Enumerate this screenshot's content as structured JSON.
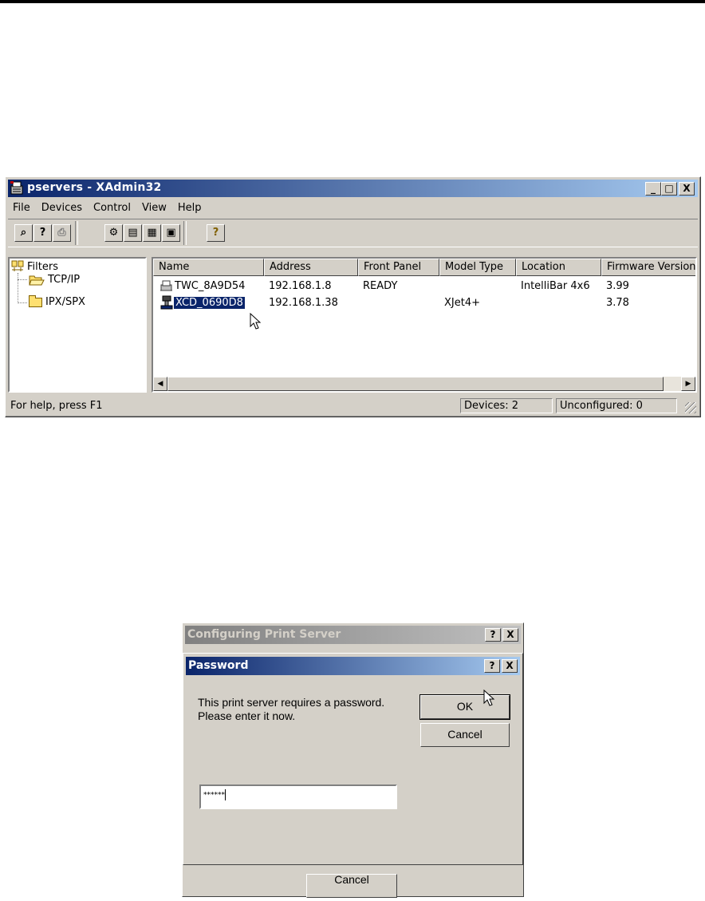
{
  "main_window": {
    "title": "pservers - XAdmin32",
    "caption_buttons": {
      "minimize": "_",
      "maximize": "□",
      "close": "X"
    },
    "menu": [
      "File",
      "Devices",
      "Control",
      "View",
      "Help"
    ],
    "toolbar_icons": [
      "search-device-icon",
      "unknown-device-icon",
      "printer-disabled-icon",
      "configure-icon",
      "status-panel-icon",
      "print-test-icon",
      "save-icon",
      "help-icon"
    ],
    "tree": {
      "root": "Filters",
      "children": [
        "TCP/IP",
        "IPX/SPX"
      ]
    },
    "columns": [
      "Name",
      "Address",
      "Front Panel",
      "Model Type",
      "Location",
      "Firmware Version"
    ],
    "rows": [
      {
        "name": "TWC_8A9D54",
        "address": "192.168.1.8",
        "front_panel": "READY",
        "model_type": "",
        "location": "IntelliBar 4x6",
        "firmware": "3.99"
      },
      {
        "name": "XCD_0690D8",
        "address": "192.168.1.38",
        "front_panel": "",
        "model_type": "XJet4+",
        "location": "",
        "firmware": "3.78"
      }
    ],
    "status": {
      "help": "For help, press F1",
      "devices": "Devices: 2",
      "unconfigured": "Unconfigured: 0"
    }
  },
  "back_dialog": {
    "title": "Configuring Print Server",
    "buttons": {
      "help": "?",
      "close": "X"
    },
    "cancel_label": "Cancel"
  },
  "password_dialog": {
    "title": "Password",
    "buttons": {
      "help": "?",
      "close": "X"
    },
    "message": "This print server requires a password. Please enter it now.",
    "ok_label": "OK",
    "cancel_label": "Cancel",
    "password_value": "******"
  }
}
